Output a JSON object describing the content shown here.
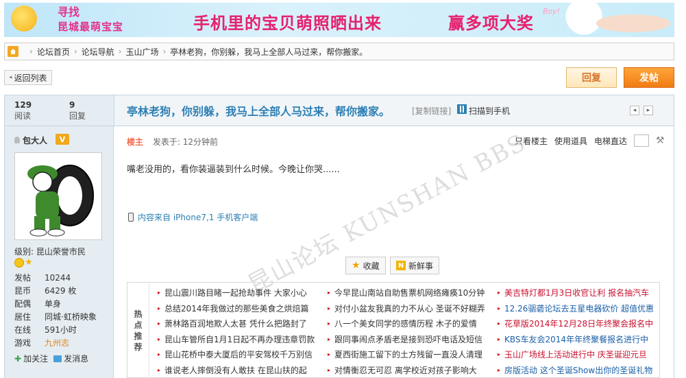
{
  "banner": {
    "find_top": "寻找",
    "find_bottom": "昆城最萌宝宝",
    "slogan_main": "手机里的宝贝萌照晒出来",
    "slogan_prize": "赢多项大奖",
    "boy_tag": "Boy!"
  },
  "breadcrumb": [
    "论坛首页",
    "论坛导航",
    "玉山广场",
    "亭林老狗，你别躲，我马上全部人马过来，帮你搬家。"
  ],
  "toolbar": {
    "back": "返回列表",
    "reply": "回复",
    "post": "发帖"
  },
  "stats": {
    "views": "129",
    "views_label": "阅读",
    "replies": "9",
    "replies_label": "回复"
  },
  "thread": {
    "title": "亭林老狗，你别躲，我马上全部人马过来，帮你搬家。",
    "copy_link": "[复制链接]",
    "scan_phone": "扫描到手机"
  },
  "author": {
    "name": "包大人",
    "vip": "V",
    "level": "级别: 昆山荣誉市民",
    "info": [
      {
        "k": "发帖",
        "v": "10244"
      },
      {
        "k": "昆币",
        "v": "6429 枚"
      },
      {
        "k": "配偶",
        "v": "单身"
      },
      {
        "k": "居住",
        "v": "同城·虹桥映象"
      },
      {
        "k": "在线",
        "v": "591小时"
      },
      {
        "k": "游戏",
        "v": "九州志"
      }
    ],
    "follow": "加关注",
    "message": "发消息"
  },
  "post": {
    "floor": "楼主",
    "time": "发表于: 12分钟前",
    "only_author": "只看楼主",
    "use_tool": "使用道具",
    "elevator": "电梯直达",
    "content": "嘴老没用的，看你装逼装到什么时候。今晚让你哭......",
    "source": "内容来自 iPhone7,1 手机客户端",
    "watermark": "昆山论坛 KUNSHAN BBS",
    "favorite": "收藏",
    "news": "新鲜事"
  },
  "hot": {
    "label": [
      "热",
      "点",
      "推",
      "荐"
    ],
    "col1": [
      "昆山震川路目睹一起抢劫事件 大家小心",
      "总结2014年我做过的那些美食之烘焙篇",
      "萧林路百润地欺人太甚 凭什么把路封了",
      "昆山车管所自1月1日起不再办理违章罚款",
      "昆山花桥中泰大厦后的平安驾校千万别信",
      "谁说老人摔倒没有人敢扶 在昆山扶的起"
    ],
    "col2": [
      "今早昆山南站自助售票机网络瘫痪10分钟",
      "对付小盆友我真的力不从心 圣诞不好糊弄",
      "八一个美女同学的感情历程 木子的爱情",
      "跟同事闹点矛盾老是接到恐吓电话及短信",
      "夏西街施工留下的土方残留一直没人清理",
      "对情衡忍无可忍 离学校近对孩子影响大"
    ],
    "col3": [
      {
        "text": "美吉特灯都1月3日收官让利 报名抽汽车",
        "style": "red"
      },
      {
        "text": "12.26骃砻论坛去五星电器砍价 超值优惠",
        "style": "blue"
      },
      {
        "text": "花草版2014年12月28日年终聚会报名中",
        "style": "red"
      },
      {
        "text": "KBS车友会2014年年终聚餐报名进行中",
        "style": "blue"
      },
      {
        "text": "玉山广场线上活动进行中 庆圣诞迎元旦",
        "style": "red"
      },
      {
        "text": "房版活动 这个圣诞Show出你的圣诞礼物",
        "style": "blue"
      }
    ]
  },
  "colors": {
    "accent_blue": "#2c7fb4",
    "post_orange": "#f07c12",
    "hot_red": "#c8102e"
  }
}
